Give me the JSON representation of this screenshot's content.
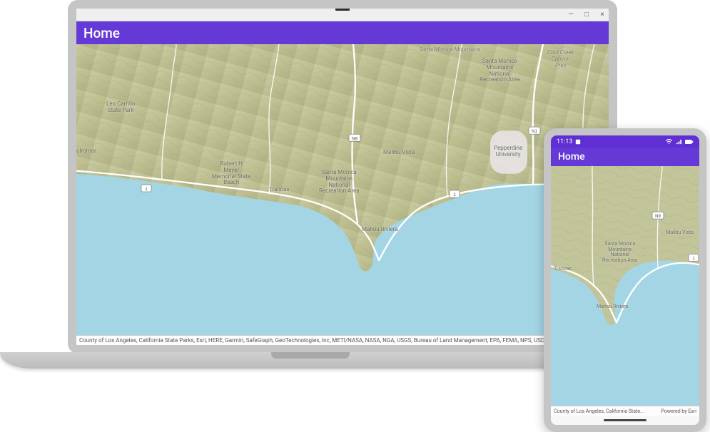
{
  "laptop": {
    "app_title": "Home",
    "win_controls": {
      "min": "—",
      "max": "□",
      "close": "×"
    },
    "drag_handle_label": "····"
  },
  "phone": {
    "status_time": "11:13",
    "app_title": "Home"
  },
  "map": {
    "labels": {
      "santa_monica_mountains": "Santa Monica Mountains",
      "santa_monica_mountains_nra": "Santa Monica\nMountains\nNational\nRecreation Area",
      "malibu_vista": "Malibu Vista",
      "pepperdine": "Pepperdine\nUniversity",
      "trancas": "Trancas",
      "mahou_riviera": "Mahou Riviera",
      "robert_meyer": "Robert H\nMeyer\nMemorial State\nBeach",
      "santa_monica_nra2": "Santa Monica\nMountains\nNational\nRecreation Area",
      "olromar": "olromar",
      "leo_carrillo": "Leo Carrillo\nState Park",
      "cold_creek": "Cold Creek\nCanyon\nPres"
    },
    "shields": {
      "hwy1_a": "1",
      "hwy1_b": "1",
      "hwy1_c": "1",
      "n1": "N1",
      "n9": "N9"
    }
  },
  "attribution": {
    "desktop": "County of Los Angeles, California State Parks, Esri, HERE, Garmin, SafeGraph, GeoTechnologies, Inc, METI/NASA, NASA, NGA, USGS, Bureau of Land Management, EPA, FEMA, NPS, USDA",
    "phone_left": "County of Los Angeles, California State...",
    "phone_right": "Powered by Esri"
  }
}
